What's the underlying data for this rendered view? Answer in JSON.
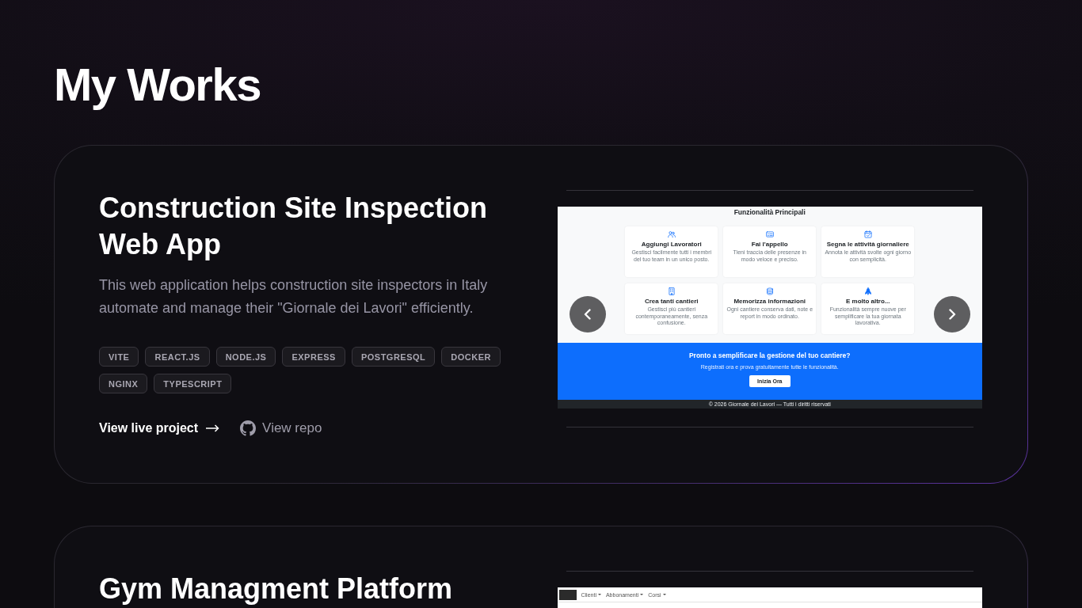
{
  "heading": "My Works",
  "projects": [
    {
      "title": "Construction Site Inspection Web App",
      "description": "This web application helps construction site inspectors in Italy automate and manage their \"Giornale dei Lavori\" efficiently.",
      "tags": [
        "VITE",
        "REACT.JS",
        "NODE.JS",
        "EXPRESS",
        "POSTGRESQL",
        "DOCKER",
        "NGINX",
        "TYPESCRIPT"
      ],
      "links": [
        {
          "kind": "live",
          "label": "View live project"
        },
        {
          "kind": "repo",
          "label": "View repo"
        }
      ],
      "preview": {
        "kind": "landing",
        "section_title": "Funzionalità Principali",
        "features": [
          {
            "title": "Aggiungi Lavoratori",
            "description": "Gestisci facilmente tutti i membri del tuo team in un unico posto."
          },
          {
            "title": "Fai l'appello",
            "description": "Tieni traccia delle presenze in modo veloce e preciso."
          },
          {
            "title": "Segna le attività giornaliere",
            "description": "Annota le attività svolte ogni giorno con semplicità."
          },
          {
            "title": "Crea tanti cantieri",
            "description": "Gestisci più cantieri contemporaneamente, senza confusione."
          },
          {
            "title": "Memorizza informazioni",
            "description": "Ogni cantiere conserva dati, note e report in modo ordinato."
          },
          {
            "title": "E molto altro...",
            "description": "Funzionalità sempre nuove per semplificare la tua giornata lavorativa."
          }
        ],
        "cta": {
          "title": "Pronto a semplificare la gestione del tuo cantiere?",
          "text": "Registrati ora e prova gratuitamente tutte le funzionalità.",
          "button": "Inizia Ora"
        },
        "footer": "© 2026 Giornale dei Lavori — Tutti i diritti riservati"
      }
    },
    {
      "title": "Gym Managment Platform",
      "preview": {
        "kind": "dashboard",
        "nav": [
          "Clienti",
          "Abbonamenti",
          "Corsi"
        ]
      }
    }
  ]
}
